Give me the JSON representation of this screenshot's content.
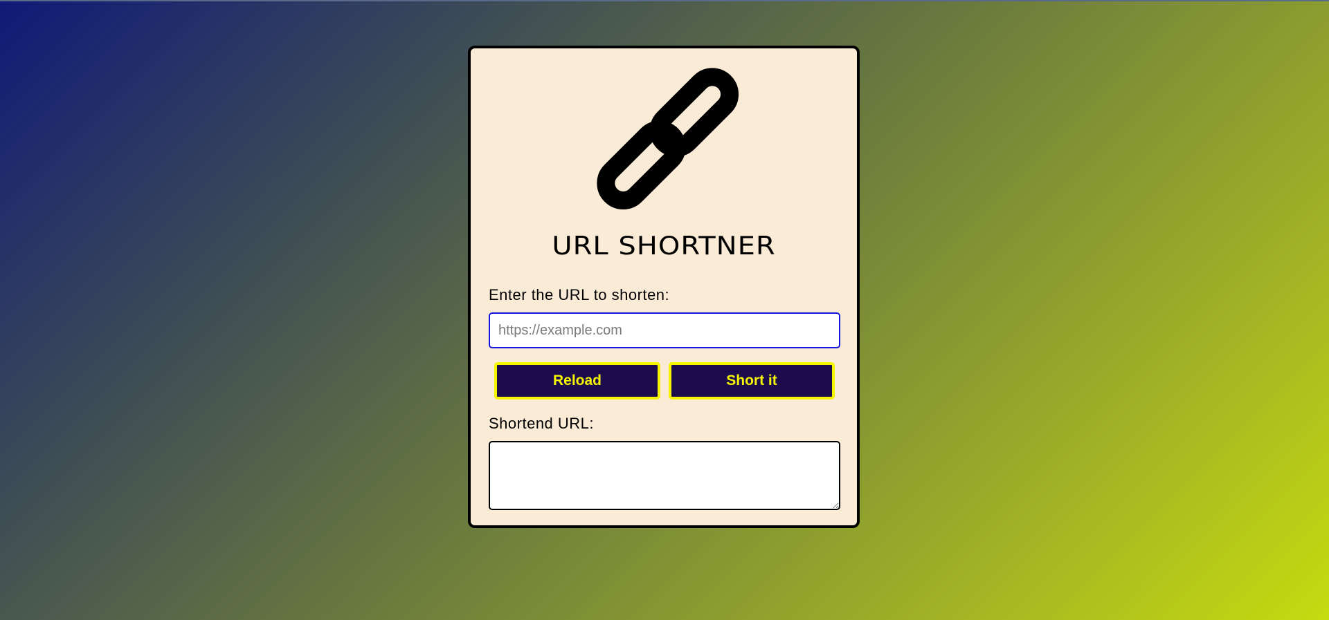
{
  "app": {
    "title": "URL SHORTNER",
    "logo_icon": "chain-link-icon"
  },
  "form": {
    "url_label": "Enter the URL to shorten:",
    "url_placeholder": "https://example.com",
    "url_value": "",
    "reload_label": "Reload",
    "short_label": "Short it",
    "result_label": "Shortend URL:",
    "result_value": ""
  },
  "colors": {
    "card_background": "#faebd7",
    "button_background": "#1c0c4e",
    "button_accent": "#f5f500",
    "input_border": "#1414e0"
  }
}
